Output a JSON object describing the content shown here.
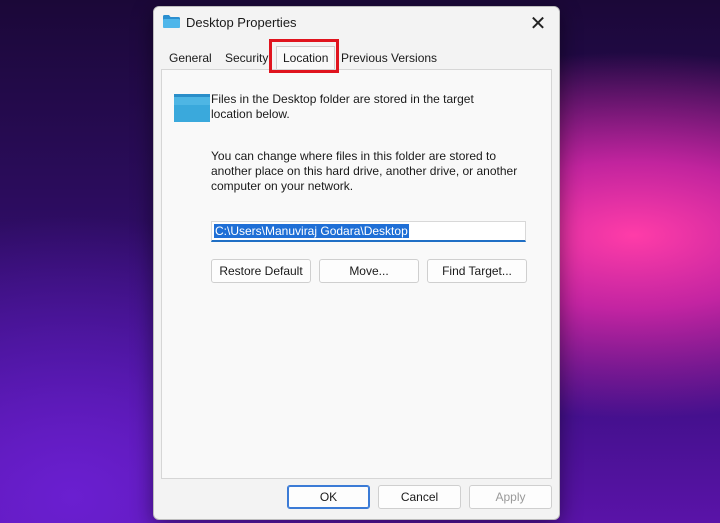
{
  "window": {
    "title": "Desktop Properties",
    "close_glyph": "✕"
  },
  "tabs": [
    {
      "label": "General"
    },
    {
      "label": "Security"
    },
    {
      "label": "Location",
      "active": true
    },
    {
      "label": "Previous Versions"
    }
  ],
  "location": {
    "intro": "Files in the Desktop folder are stored in the target location below.",
    "description": "You can change where files in this folder are stored to another place on this hard drive, another drive, or another computer on your network.",
    "path_value": "C:\\Users\\Manuviraj Godara\\Desktop",
    "buttons": {
      "restore": "Restore Default",
      "move": "Move...",
      "find": "Find Target..."
    }
  },
  "footer": {
    "ok": "OK",
    "cancel": "Cancel",
    "apply": "Apply"
  },
  "colors": {
    "highlight": "#e0141e",
    "selection": "#1f6fd6",
    "folder": "#39a7da"
  }
}
